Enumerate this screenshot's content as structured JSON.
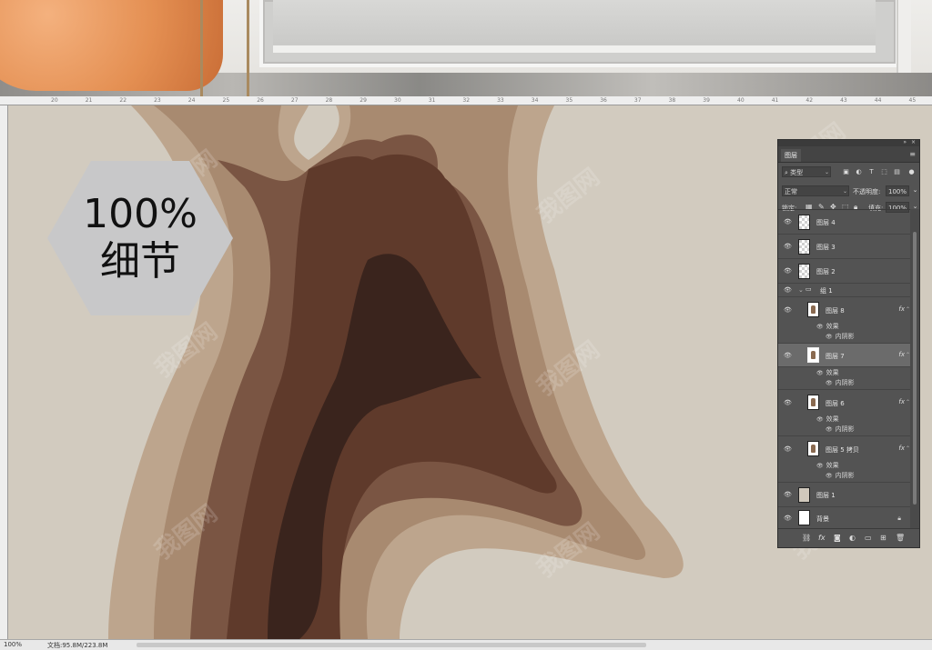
{
  "canvas_badge": {
    "line1": "100%",
    "line2": "细节"
  },
  "status_bar": {
    "zoom": "100%",
    "doc_info": "文档:95.8M/223.8M"
  },
  "ruler_ticks": [
    "20",
    "21",
    "22",
    "23",
    "24",
    "25",
    "26",
    "27",
    "28",
    "29",
    "30",
    "31",
    "32",
    "33",
    "34",
    "35",
    "36",
    "37",
    "38",
    "39",
    "40",
    "41",
    "42",
    "43",
    "44",
    "45"
  ],
  "watermark_text": "我图网",
  "layers_panel": {
    "title": "图层",
    "kind_filter": "类型",
    "blend_mode": "正常",
    "opacity_label": "不透明度:",
    "opacity_value": "100%",
    "lock_label": "锁定:",
    "fill_label": "填充:",
    "fill_value": "100%",
    "layers": [
      {
        "name": "图层 4"
      },
      {
        "name": "图层 3"
      },
      {
        "name": "图层 2"
      },
      {
        "name": "组 1"
      },
      {
        "name": "图层 8",
        "fx": "fx",
        "effects_label": "效果",
        "effect": "内阴影"
      },
      {
        "name": "图层 7",
        "fx": "fx",
        "effects_label": "效果",
        "effect": "内阴影"
      },
      {
        "name": "图层 6",
        "fx": "fx",
        "effects_label": "效果",
        "effect": "内阴影"
      },
      {
        "name": "图层 5 拷贝",
        "fx": "fx",
        "effects_label": "效果",
        "effect": "内阴影"
      },
      {
        "name": "图层 1"
      },
      {
        "name": "背景"
      }
    ],
    "bottom_icons": [
      "link-icon",
      "fx-icon",
      "mask-icon",
      "adjustment-icon",
      "folder-icon",
      "new-layer-icon",
      "trash-icon"
    ],
    "fx_symbol": "fx"
  },
  "colors": {
    "canvas_bg": "#d2cbbf",
    "panel_bg": "#535353",
    "selected_row": "#6b6b6b"
  }
}
